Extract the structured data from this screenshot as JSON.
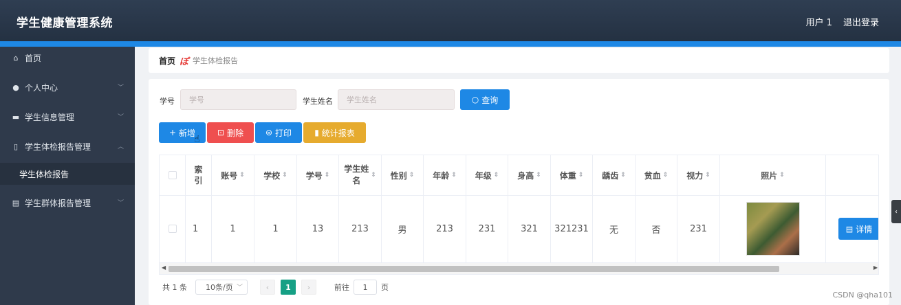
{
  "header": {
    "title": "学生健康管理系统",
    "user": "用户 1",
    "logout": "退出登录"
  },
  "sidebar": {
    "items": [
      {
        "icon": "home-icon",
        "glyph": "⌂",
        "label": "首页"
      },
      {
        "icon": "user-icon",
        "glyph": "👤",
        "label": "个人中心"
      },
      {
        "icon": "id-card-icon",
        "glyph": "▬",
        "label": "学生信息管理"
      },
      {
        "icon": "thermometer-icon",
        "glyph": "🌡",
        "label": "学生体检报告管理"
      },
      {
        "icon": "document-icon",
        "glyph": "▤",
        "label": "学生群体报告管理"
      }
    ],
    "sub_item": "学生体检报告"
  },
  "breadcrumb": {
    "home": "首页",
    "separator": "ぽ",
    "current": "学生体检报告"
  },
  "search": {
    "student_id_label": "学号",
    "student_id_placeholder": "学号",
    "name_label": "学生姓名",
    "name_placeholder": "学生姓名",
    "query_button": "查询"
  },
  "actions": {
    "add": "新增",
    "delete": "删除",
    "print": "打印",
    "stats": "统计报表"
  },
  "table": {
    "headers": [
      "索\n引",
      "账号",
      "学校",
      "学号",
      "学生姓\n名",
      "性别",
      "年龄",
      "年级",
      "身高",
      "体重",
      "龋齿",
      "贫血",
      "视力",
      "照片"
    ],
    "row": [
      "1",
      "1",
      "1",
      "13",
      "213",
      "男",
      "213",
      "231",
      "321",
      "321231",
      "无",
      "否",
      "231"
    ],
    "detail_button": "详情"
  },
  "pagination": {
    "total": "共 1 条",
    "page_size": "10条/页",
    "current_page": "1",
    "goto_label": "前往",
    "goto_value": "1",
    "page_suffix": "页"
  },
  "watermark": "CSDN @qha101",
  "colors": {
    "primary": "#1e88e5",
    "danger": "#ef4f4f",
    "warning": "#e6ab2e",
    "header_bg": "#2f3e52",
    "sidebar_bg": "#2f3a4b",
    "active_page": "#16a085"
  }
}
